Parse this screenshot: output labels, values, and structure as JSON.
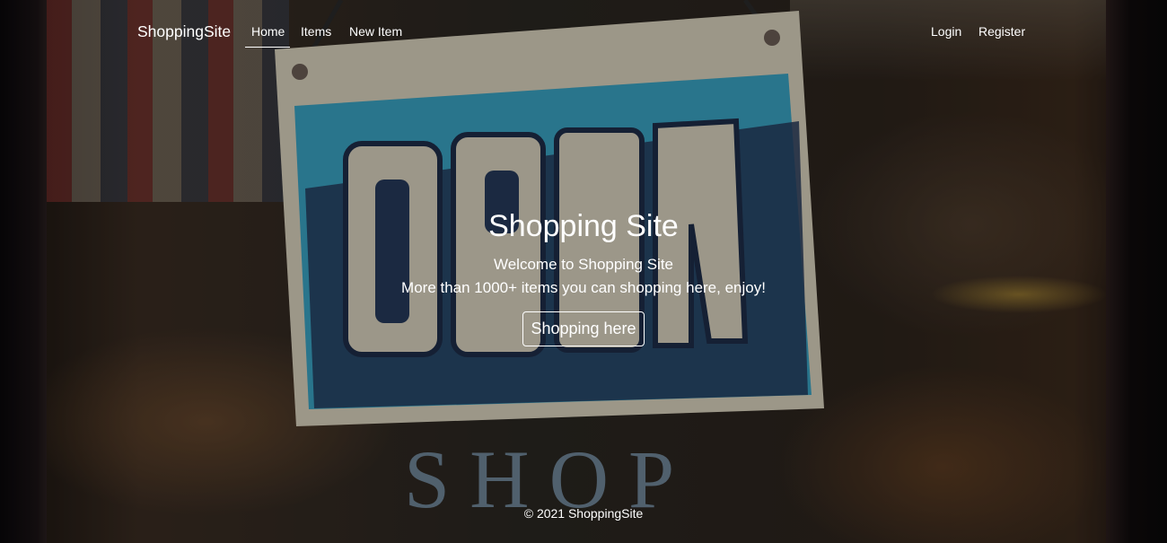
{
  "navbar": {
    "brand": "ShoppingSite",
    "links": [
      {
        "label": "Home",
        "active": true
      },
      {
        "label": "Items",
        "active": false
      },
      {
        "label": "New Item",
        "active": false
      }
    ],
    "right_links": [
      {
        "label": "Login"
      },
      {
        "label": "Register"
      }
    ]
  },
  "hero": {
    "title": "Shopping Site",
    "subtitle": "Welcome to Shopping Site",
    "tagline": "More than 1000+ items you can shopping here, enjoy!",
    "button_label": "Shopping here",
    "background_sign_text": "OPEN",
    "background_window_text": "SHOP"
  },
  "footer": {
    "copyright": "© 2021 ShoppingSite"
  },
  "colors": {
    "sign_blue": "#3fa8c8",
    "sign_navy": "#253a5c",
    "sign_cream": "#e4ddc9",
    "text": "#ffffff"
  }
}
